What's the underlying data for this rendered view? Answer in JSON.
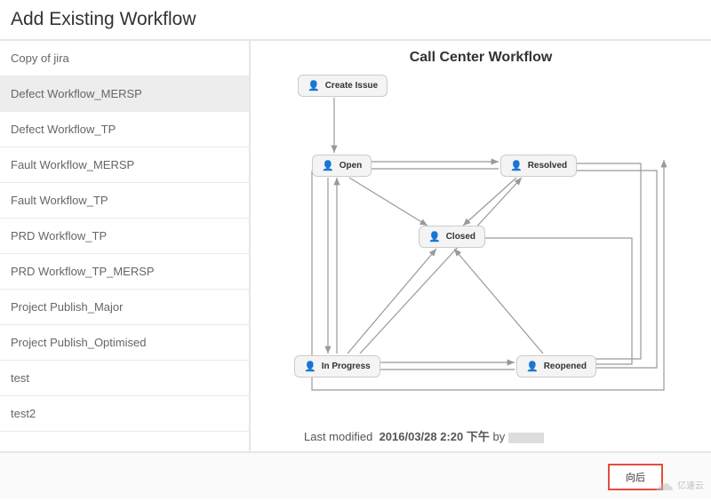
{
  "header": {
    "title": "Add Existing Workflow"
  },
  "sidebar": {
    "items": [
      {
        "label": "Copy of jira",
        "selected": false
      },
      {
        "label": "Defect Workflow_MERSP",
        "selected": true
      },
      {
        "label": "Defect Workflow_TP",
        "selected": false
      },
      {
        "label": "Fault Workflow_MERSP",
        "selected": false
      },
      {
        "label": "Fault Workflow_TP",
        "selected": false
      },
      {
        "label": "PRD Workflow_TP",
        "selected": false
      },
      {
        "label": "PRD Workflow_TP_MERSP",
        "selected": false
      },
      {
        "label": "Project Publish_Major",
        "selected": false
      },
      {
        "label": "Project Publish_Optimised",
        "selected": false
      },
      {
        "label": "test",
        "selected": false
      },
      {
        "label": "test2",
        "selected": false
      }
    ]
  },
  "main": {
    "diagram_title": "Call Center Workflow",
    "statuses": {
      "create": "Create Issue",
      "open": "Open",
      "resolved": "Resolved",
      "closed": "Closed",
      "in_progress": "In Progress",
      "reopened": "Reopened"
    },
    "transitions": [
      [
        "create",
        "open"
      ],
      [
        "open",
        "resolved"
      ],
      [
        "open",
        "closed"
      ],
      [
        "open",
        "in_progress"
      ],
      [
        "resolved",
        "closed"
      ],
      [
        "resolved",
        "reopened"
      ],
      [
        "closed",
        "reopened"
      ],
      [
        "in_progress",
        "open"
      ],
      [
        "in_progress",
        "closed"
      ],
      [
        "in_progress",
        "resolved"
      ],
      [
        "in_progress",
        "reopened"
      ],
      [
        "reopened",
        "in_progress"
      ],
      [
        "reopened",
        "closed"
      ],
      [
        "reopened",
        "resolved"
      ]
    ],
    "last_modified_label": "Last modified",
    "last_modified_date": "2016/03/28 2:20 下午",
    "last_modified_by": "by"
  },
  "footer": {
    "back_label": "向后"
  },
  "watermark": {
    "text": "亿速云"
  }
}
